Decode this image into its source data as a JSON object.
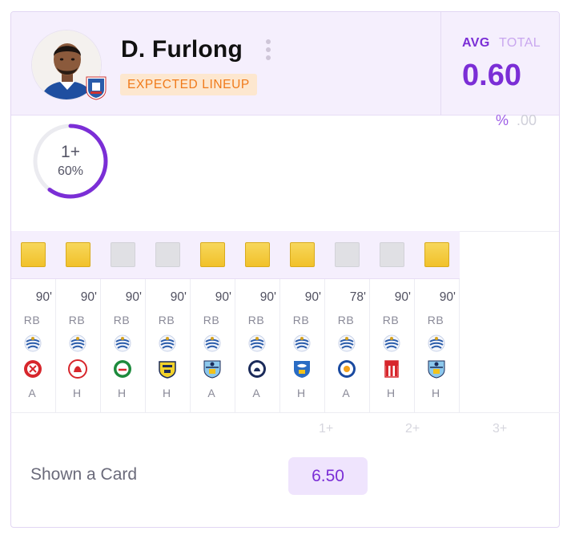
{
  "player": {
    "name": "D. Furlong",
    "status_tag": "EXPECTED LINEUP",
    "menu_icon": "kebab-menu-icon"
  },
  "stat_toggle": {
    "avg_label": "AVG",
    "total_label": "TOTAL",
    "active": "AVG",
    "value": "0.60"
  },
  "format_toggle": {
    "percent_label": "%",
    "decimal_label": ".00",
    "active": "%"
  },
  "ring": {
    "label": "1+",
    "percent_text": "60%",
    "fraction": 0.6,
    "color": "#7b2ed6"
  },
  "matches": [
    {
      "card": "yellow",
      "minutes": "90'",
      "position": "RB",
      "venue": "A",
      "opponent_crest": "sheffield-united-crest-icon"
    },
    {
      "card": "yellow",
      "minutes": "90'",
      "position": "RB",
      "venue": "H",
      "opponent_crest": "bristol-city-crest-icon"
    },
    {
      "card": "none",
      "minutes": "90'",
      "position": "RB",
      "venue": "H",
      "opponent_crest": "blackburn-crest-icon"
    },
    {
      "card": "none",
      "minutes": "90'",
      "position": "RB",
      "venue": "H",
      "opponent_crest": "oxford-united-crest-icon"
    },
    {
      "card": "yellow",
      "minutes": "90'",
      "position": "RB",
      "venue": "A",
      "opponent_crest": "coventry-crest-icon"
    },
    {
      "card": "yellow",
      "minutes": "90'",
      "position": "RB",
      "venue": "A",
      "opponent_crest": "millwall-crest-icon"
    },
    {
      "card": "yellow",
      "minutes": "90'",
      "position": "RB",
      "venue": "H",
      "opponent_crest": "sheffield-wednesday-crest-icon"
    },
    {
      "card": "none",
      "minutes": "78'",
      "position": "RB",
      "venue": "A",
      "opponent_crest": "leicester-crest-icon"
    },
    {
      "card": "none",
      "minutes": "90'",
      "position": "RB",
      "venue": "H",
      "opponent_crest": "stoke-crest-icon"
    },
    {
      "card": "yellow",
      "minutes": "90'",
      "position": "RB",
      "venue": "H",
      "opponent_crest": "coventry-crest-icon"
    }
  ],
  "thresholds": [
    "1+",
    "2+",
    "3+"
  ],
  "market": {
    "label": "Shown a Card",
    "odds": "6.50"
  },
  "colors": {
    "accent": "#7b2ed6",
    "header_bg": "#f5effd",
    "tag_bg": "#fde7cf",
    "tag_text": "#f07a1a",
    "yellow_card": "#f1c12a"
  }
}
